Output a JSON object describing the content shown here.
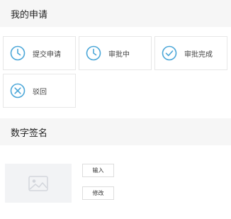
{
  "applications": {
    "title": "我的申请",
    "items": [
      {
        "label": "提交申请",
        "icon": "clock-icon"
      },
      {
        "label": "审批中",
        "icon": "clock-icon"
      },
      {
        "label": "审批完成",
        "icon": "check-circle-icon"
      },
      {
        "label": "驳回",
        "icon": "x-circle-icon"
      }
    ]
  },
  "signature": {
    "title": "数字签名",
    "placeholder_icon": "image-placeholder-icon",
    "input_label": "输入",
    "edit_label": "修改"
  },
  "colors": {
    "icon_blue": "#4aa6d8",
    "header_bg": "#f6f6f6",
    "placeholder_bg": "#f2f3f5"
  }
}
